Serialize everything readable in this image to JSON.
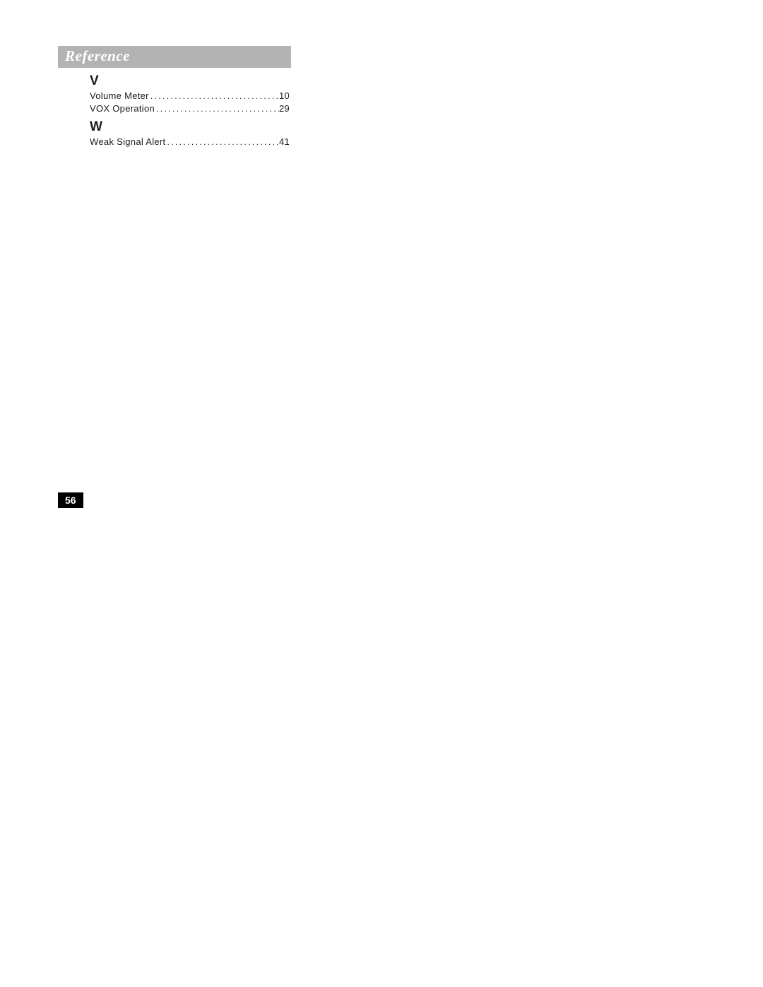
{
  "header": "Reference",
  "sections": [
    {
      "letter": "V",
      "entries": [
        {
          "label": "Volume Meter",
          "page": "10"
        },
        {
          "label": "VOX Operation",
          "page": "29"
        }
      ]
    },
    {
      "letter": "W",
      "entries": [
        {
          "label": "Weak Signal Alert",
          "page": "41"
        }
      ]
    }
  ],
  "pageNumber": "56",
  "dots": "........................................................"
}
